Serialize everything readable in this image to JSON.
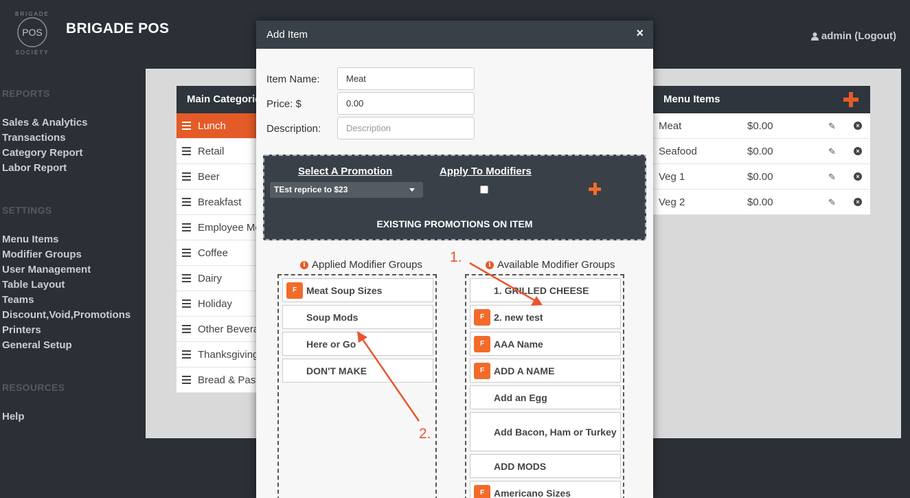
{
  "brand": {
    "logo_top": "BRIGADE",
    "logo_center": "POS",
    "logo_bottom": "SOCIETY",
    "name": "BRIGADE POS"
  },
  "user": {
    "icon": "user-icon",
    "label": "admin (Logout)"
  },
  "sidebar": {
    "reports_heading": "REPORTS",
    "reports": [
      "Sales & Analytics",
      "Transactions",
      "Category Report",
      "Labor Report"
    ],
    "settings_heading": "SETTINGS",
    "settings": [
      "Menu Items",
      "Modifier Groups",
      "User Management",
      "Table Layout",
      "Teams",
      "Discount,Void,Promotions",
      "Printers",
      "General Setup"
    ],
    "resources_heading": "RESOURCES",
    "resources": [
      "Help"
    ]
  },
  "categories": {
    "header": "Main Categories",
    "items": [
      "Lunch",
      "Retail",
      "Beer",
      "Breakfast",
      "Employee Meals",
      "Coffee",
      "Dairy",
      "Holiday",
      "Other Beverages",
      "Thanksgiving",
      "Bread & Pastry"
    ],
    "active_index": 0
  },
  "menu_items": {
    "header": "Menu Items",
    "rows": [
      {
        "name": "Meat",
        "price": "$0.00"
      },
      {
        "name": "Seafood",
        "price": "$0.00"
      },
      {
        "name": "Veg 1",
        "price": "$0.00"
      },
      {
        "name": "Veg 2",
        "price": "$0.00"
      }
    ]
  },
  "modal": {
    "title": "Add Item",
    "close": "×",
    "item_name_label": "Item Name:",
    "item_name_value": "Meat",
    "price_label": "Price: $",
    "price_value": "0.00",
    "description_label": "Description:",
    "description_placeholder": "Description",
    "promotion": {
      "select_heading": "Select A Promotion",
      "selected": "TEst reprice to $23",
      "apply_heading": "Apply To Modifiers",
      "apply_checked": false,
      "existing_heading": "EXISTING PROMOTIONS ON ITEM"
    },
    "applied_title": "Applied Modifier Groups",
    "applied": [
      {
        "label": "Meat Soup Sizes",
        "badge": "F"
      },
      {
        "label": "Soup Mods",
        "badge": ""
      },
      {
        "label": "Here or Go",
        "badge": ""
      },
      {
        "label": "DON'T MAKE",
        "badge": ""
      }
    ],
    "available_title": "Available Modifier Groups",
    "available": [
      {
        "label": "1. GRILLED CHEESE",
        "badge": ""
      },
      {
        "label": "2. new test",
        "badge": "F"
      },
      {
        "label": "AAA Name",
        "badge": "F"
      },
      {
        "label": "ADD A NAME",
        "badge": "F"
      },
      {
        "label": "Add an Egg",
        "badge": ""
      },
      {
        "label": "Add Bacon, Ham or Turkey",
        "badge": ""
      },
      {
        "label": "ADD MODS",
        "badge": ""
      },
      {
        "label": "Americano Sizes",
        "badge": "F"
      }
    ]
  },
  "annotations": {
    "one": "1.",
    "two": "2.",
    "color": "#e8562e"
  },
  "colors": {
    "accent": "#e45b28",
    "header_dark": "#2f353c",
    "background": "#2b3036"
  }
}
